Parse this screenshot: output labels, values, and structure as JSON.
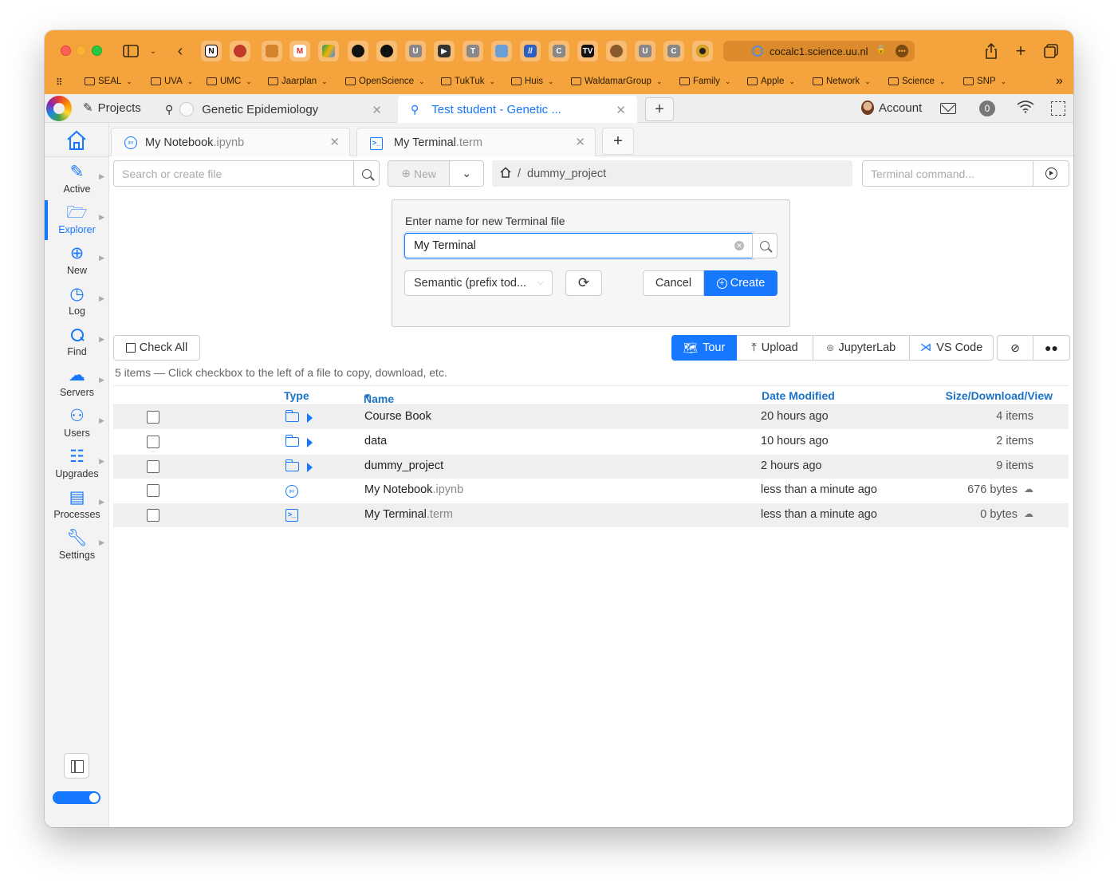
{
  "browser": {
    "url": "cocalc1.science.uu.nl",
    "bookmarks": [
      "SEAL",
      "UVA",
      "UMC",
      "Jaarplan",
      "OpenScience",
      "TukTuk",
      "Huis",
      "WaldamarGroup",
      "Family",
      "Apple",
      "Network",
      "Science",
      "SNP"
    ]
  },
  "cocalc": {
    "projects_label": "Projects",
    "project_tabs": [
      {
        "label": "Genetic Epidemiology"
      },
      {
        "label": "Test student - Genetic ..."
      }
    ],
    "account_label": "Account",
    "notification_count": "0"
  },
  "sidebar": {
    "items": [
      {
        "label": "Active",
        "icon": "pencil-icon"
      },
      {
        "label": "Explorer",
        "icon": "folder-open-icon"
      },
      {
        "label": "New",
        "icon": "plus-circle-icon"
      },
      {
        "label": "Log",
        "icon": "clock-icon"
      },
      {
        "label": "Find",
        "icon": "search-icon"
      },
      {
        "label": "Servers",
        "icon": "cloud-server-icon"
      },
      {
        "label": "Users",
        "icon": "users-icon"
      },
      {
        "label": "Upgrades",
        "icon": "sliders-icon"
      },
      {
        "label": "Processes",
        "icon": "cpu-icon"
      },
      {
        "label": "Settings",
        "icon": "wrench-icon"
      }
    ]
  },
  "file_tabs": [
    {
      "name": "My Notebook",
      "ext": ".ipynb"
    },
    {
      "name": "My Terminal",
      "ext": ".term"
    }
  ],
  "explorer": {
    "search_placeholder": "Search or create file",
    "new_label": "New",
    "path": "dummy_project",
    "terminal_placeholder": "Terminal command..."
  },
  "dialog": {
    "title": "Enter name for new Terminal file",
    "value": "My Terminal",
    "naming_mode": "Semantic (prefix tod...",
    "cancel_label": "Cancel",
    "create_label": "Create"
  },
  "actions": {
    "check_all": "Check All",
    "tour": "Tour",
    "upload": "Upload",
    "jupyterlab": "JupyterLab",
    "vscode": "VS Code"
  },
  "info_text": "5 items — Click checkbox to the left of a file to copy, download, etc.",
  "table": {
    "headers": {
      "type": "Type",
      "name": "Name",
      "date": "Date Modified",
      "size": "Size/Download/View"
    },
    "rows": [
      {
        "name": "Course Book",
        "ext": "",
        "date": "20 hours ago",
        "size": "4 items",
        "kind": "folder"
      },
      {
        "name": "data",
        "ext": "",
        "date": "10 hours ago",
        "size": "2 items",
        "kind": "folder"
      },
      {
        "name": "dummy_project",
        "ext": "",
        "date": "2 hours ago",
        "size": "9 items",
        "kind": "folder"
      },
      {
        "name": "My Notebook",
        "ext": ".ipynb",
        "date": "less than a minute ago",
        "size": "676 bytes",
        "kind": "notebook"
      },
      {
        "name": "My Terminal",
        "ext": ".term",
        "date": "less than a minute ago",
        "size": "0 bytes",
        "kind": "terminal"
      }
    ]
  },
  "colors": {
    "accent": "#1677ff",
    "safari_bar": "#f5a33c",
    "header_text": "#1a73c8"
  }
}
